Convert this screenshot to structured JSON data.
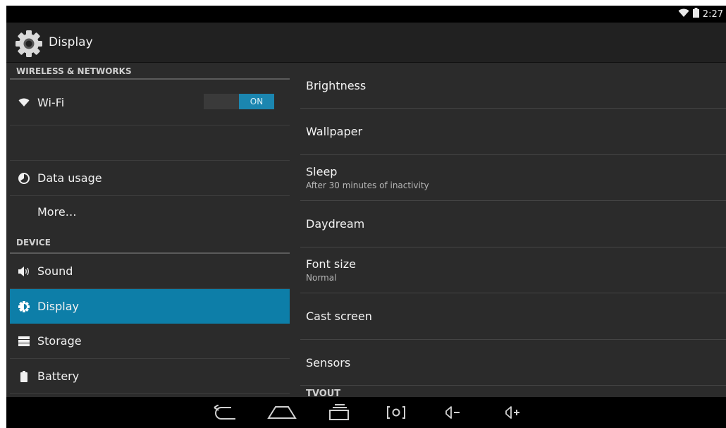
{
  "status": {
    "time": "2:27",
    "wifi_icon": "wifi-icon",
    "battery_icon": "battery-icon"
  },
  "actionbar": {
    "title": "Display",
    "icon": "settings-gear-icon"
  },
  "sidebar": {
    "headers": [
      "WIRELESS & NETWORKS",
      "DEVICE"
    ],
    "items": [
      {
        "label": "Wi-Fi",
        "icon": "wifi-icon",
        "toggle": "ON"
      },
      {
        "label": ""
      },
      {
        "label": "Data usage",
        "icon": "data-usage-icon"
      },
      {
        "label": "More…"
      },
      {
        "label": "Sound",
        "icon": "sound-icon"
      },
      {
        "label": "Display",
        "icon": "display-icon",
        "selected": true
      },
      {
        "label": "Storage",
        "icon": "storage-icon"
      },
      {
        "label": "Battery",
        "icon": "battery-icon"
      }
    ]
  },
  "display_settings": [
    {
      "title": "Brightness"
    },
    {
      "title": "Wallpaper"
    },
    {
      "title": "Sleep",
      "summary": "After 30 minutes of inactivity"
    },
    {
      "title": "Daydream"
    },
    {
      "title": "Font size",
      "summary": "Normal"
    },
    {
      "title": "Cast screen"
    },
    {
      "title": "Sensors"
    },
    {
      "title": "TVOUT"
    }
  ],
  "navbar": [
    "back-icon",
    "home-icon",
    "recents-icon",
    "screenshot-icon",
    "volume-down-icon",
    "volume-up-icon"
  ],
  "colors": {
    "accent": "#0d7ea8",
    "toggle_on": "#1b86b0",
    "background": "#2b2b2b",
    "actionbar": "#212121"
  }
}
